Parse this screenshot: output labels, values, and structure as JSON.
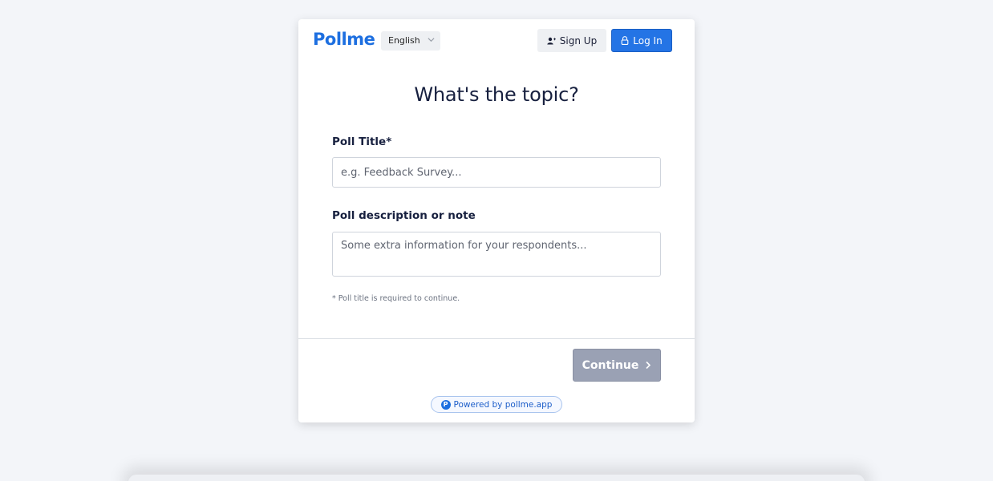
{
  "header": {
    "logo": "Pollme",
    "language": "English",
    "signup_label": "Sign Up",
    "login_label": "Log In"
  },
  "main": {
    "title": "What's the topic?",
    "poll_title_label": "Poll Title*",
    "poll_title_placeholder": "e.g. Feedback Survey...",
    "poll_title_value": "",
    "description_label": "Poll description or note",
    "description_placeholder": "Some extra information for your respondents...",
    "description_value": "",
    "hint": "* Poll title is required to continue."
  },
  "footer": {
    "continue_label": "Continue",
    "powered_by": "Powered by pollme.app",
    "powered_badge": "P"
  },
  "icons": {
    "signup": "user-plus-icon",
    "login": "lock-icon",
    "continue": "chevron-right-icon",
    "language": "chevron-down-icon"
  },
  "colors": {
    "brand": "#1d6fe0",
    "login_button": "#2474e5",
    "continue_disabled": "#9aa1b4",
    "title_text": "#17203f"
  }
}
